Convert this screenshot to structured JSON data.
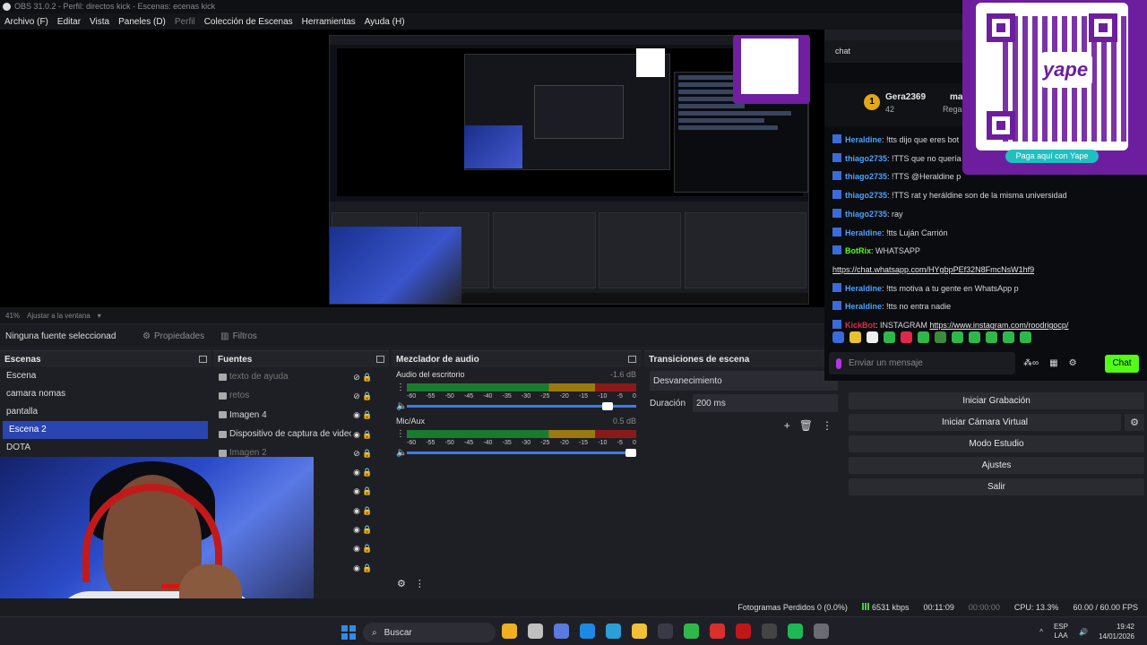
{
  "window": {
    "title": "OBS 31.0.2 - Perfil: directos kick - Escenas: ecenas kick"
  },
  "menu": [
    "Archivo (F)",
    "Editar",
    "Vista",
    "Paneles (D)",
    "Perfil",
    "Colección de Escenas",
    "Herramientas",
    "Ayuda (H)"
  ],
  "preview": {
    "zoom": "41%",
    "fit_label": "Ajustar a la ventana"
  },
  "toolbar": {
    "no_source": "Ninguna fuente seleccionad",
    "properties": "Propiedades",
    "filters": "Filtros"
  },
  "scenes": {
    "title": "Escenas",
    "items": [
      "Escena",
      "camara nomas",
      "pantalla",
      "Escena 2",
      "DOTA"
    ],
    "selected": "Escena 2"
  },
  "sources": {
    "title": "Fuentes",
    "items": [
      {
        "name": "texto de ayuda",
        "hidden": true
      },
      {
        "name": "retos",
        "hidden": true
      },
      {
        "name": "Imagen 4",
        "hidden": false
      },
      {
        "name": "Dispositivo de captura de video",
        "hidden": false
      },
      {
        "name": "Imagen 2",
        "hidden": true
      },
      {
        "name": "",
        "hidden": false
      },
      {
        "name": "",
        "hidden": false
      },
      {
        "name": "",
        "hidden": false
      },
      {
        "name": "",
        "hidden": false
      },
      {
        "name": "",
        "hidden": false
      },
      {
        "name": "",
        "hidden": false
      }
    ]
  },
  "audio": {
    "title": "Mezclador de audio",
    "channels": [
      {
        "name": "Audio del escritorio",
        "db": "-1.6 dB",
        "level": 0.9
      },
      {
        "name": "Mic/Aux",
        "db": "0.5 dB",
        "level": 1.0
      }
    ],
    "ticks": [
      "-60",
      "-55",
      "-50",
      "-45",
      "-40",
      "-35",
      "-30",
      "-25",
      "-20",
      "-15",
      "-10",
      "-5",
      "0"
    ]
  },
  "transitions": {
    "title": "Transiciones de escena",
    "selected": "Desvanecimiento",
    "duration_label": "Duración",
    "duration_value": "200 ms"
  },
  "controls": {
    "buttons": [
      "Iniciar Grabación",
      "Iniciar Cámara Virtual",
      "Modo Estudio",
      "Ajustes",
      "Salir"
    ]
  },
  "chat": {
    "title": "chat",
    "pinned": {
      "level": "1",
      "user": "Gera2369",
      "count": "42",
      "user2": "mac",
      "sub2": "Regal"
    },
    "messages": [
      {
        "user": "Heraldine",
        "color": "#4aa3ff",
        "text": " !tts dijo que eres bot"
      },
      {
        "user": "thiago2735",
        "color": "#4aa3ff",
        "text": " !TTS que no quería"
      },
      {
        "user": "thiago2735",
        "color": "#4aa3ff",
        "text": " !TTS @Heraldine p"
      },
      {
        "user": "thiago2735",
        "color": "#4aa3ff",
        "text": " !TTS rat y heráldine son de la misma universidad"
      },
      {
        "user": "thiago2735",
        "color": "#4aa3ff",
        "text": " ray"
      },
      {
        "user": "Heraldine",
        "color": "#4aa3ff",
        "text": " !tts Luján Carrión"
      },
      {
        "user": "BotRix",
        "color": "#53fc18",
        "text": " WHATSAPP"
      },
      {
        "user": "",
        "color": "#ffffff",
        "text": "",
        "link": "https://chat.whatsapp.com/HYgbpPEf32N8FmcNsW1hf9"
      },
      {
        "user": "Heraldine",
        "color": "#4aa3ff",
        "text": " !tts motiva a tu gente en WhatsApp p"
      },
      {
        "user": "Heraldine",
        "color": "#4aa3ff",
        "text": " !tts no entra nadie"
      },
      {
        "user": "KickBot",
        "color": "#e0294a",
        "text": " INSTAGRAM ",
        "link": "https://www.instagram.com/roodrigocp/"
      }
    ],
    "input_placeholder": "Enviar un mensaje",
    "send": "Chat",
    "emote_colors": [
      "#3a6bd8",
      "#e8c030",
      "#eee",
      "#2fb84a",
      "#e0294a",
      "#2fb84a",
      "#3d8a3d",
      "#2fb84a",
      "#2fb84a",
      "#2fb84a",
      "#2fb84a",
      "#2fb84a"
    ]
  },
  "qr": {
    "brand": "yape",
    "cta": "Paga aquí con Yape"
  },
  "status": {
    "frames": "Fotogramas Perdidos 0 (0.0%)",
    "kbps": "6531 kbps",
    "stream_time": "00:11:09",
    "rec_time": "00:00:00",
    "cpu": "CPU: 13.3%",
    "fps": "60.00 / 60.00 FPS"
  },
  "taskbar": {
    "search": "Buscar",
    "lang1": "ESP",
    "lang2": "LAA",
    "time": "19:42",
    "date": "14/01/2026",
    "app_colors": [
      "#f0b020",
      "#c0c0c0",
      "#5a7ae0",
      "#1e88e5",
      "#2a9fd8",
      "#f2c037",
      "#3a3a46",
      "#2fb84a",
      "#d9302b",
      "#c0161a",
      "#444",
      "#1db954",
      "#6b6b73"
    ]
  }
}
